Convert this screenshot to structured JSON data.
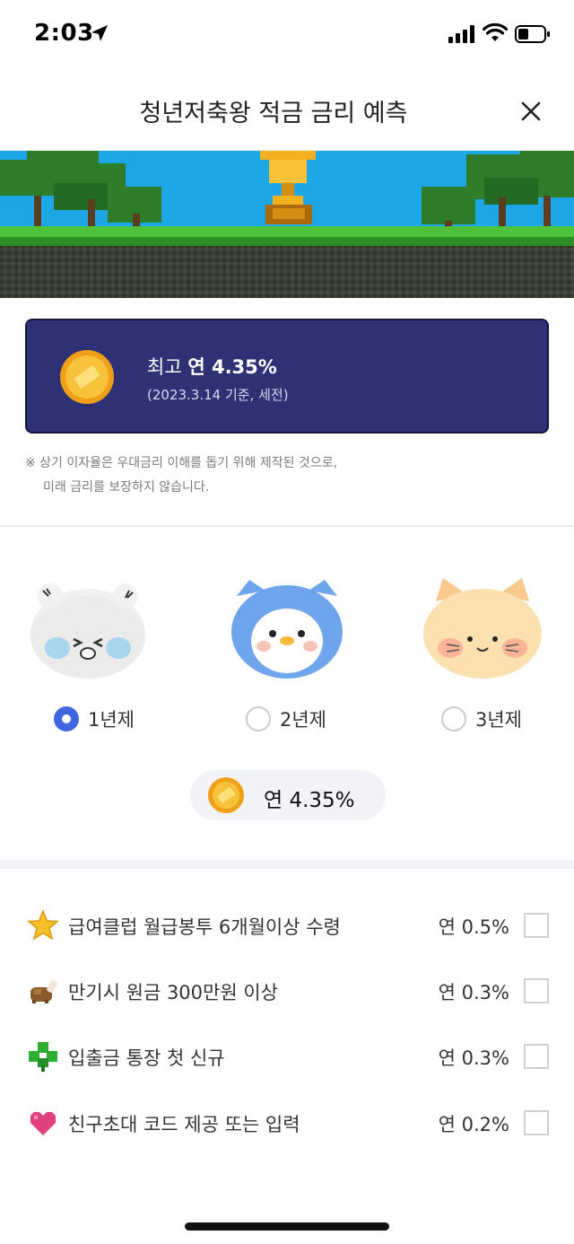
{
  "status_bar": {
    "time": "2:03"
  },
  "header": {
    "title": "청년저축왕 적금 금리 예측"
  },
  "rate_card": {
    "prefix": "최고 ",
    "rate": "연 4.35%",
    "basis": "(2023.3.14 기준, 세전)"
  },
  "disclaimer": {
    "line1": "※ 상기 이자율은 우대금리 이해를 돕기 위해 제작된 것으로,",
    "line2": "미래 금리를 보장하지 않습니다."
  },
  "terms": [
    {
      "label": "1년제",
      "selected": true
    },
    {
      "label": "2년제",
      "selected": false
    },
    {
      "label": "3년제",
      "selected": false
    }
  ],
  "predicted_rate": "연 4.35%",
  "bonuses": [
    {
      "icon": "star-icon",
      "label": "급여클럽 월급봉투 6개월이상 수령",
      "rate": "연 0.5%"
    },
    {
      "icon": "piggy-bank-icon",
      "label": "만기시 원금 300만원 이상",
      "rate": "연 0.3%"
    },
    {
      "icon": "clover-icon",
      "label": "입출금 통장 첫 신규",
      "rate": "연 0.3%"
    },
    {
      "icon": "heart-icon",
      "label": "친구초대 코드 제공 또는 입력",
      "rate": "연 0.2%"
    }
  ],
  "colors": {
    "card_bg": "#2e3173",
    "radio_selected": "#3f65e0",
    "pill_bg": "#f1f3f7"
  }
}
